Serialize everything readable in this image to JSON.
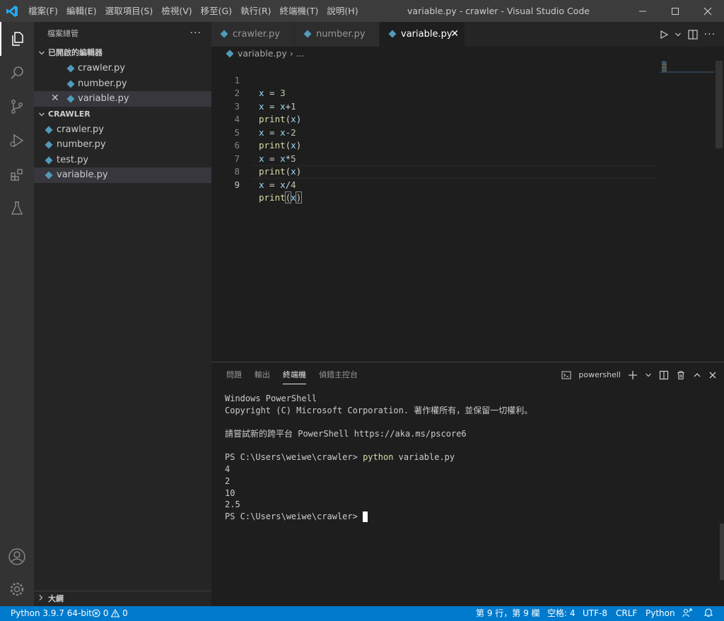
{
  "titlebar": {
    "menus": [
      "檔案(F)",
      "編輯(E)",
      "選取項目(S)",
      "檢視(V)",
      "移至(G)",
      "執行(R)",
      "終端機(T)",
      "說明(H)"
    ],
    "title": "variable.py - crawler - Visual Studio Code"
  },
  "sidebar": {
    "title": "檔案總管",
    "more": "···",
    "open_editors": {
      "header": "已開啟的編輯器",
      "items": [
        "crawler.py",
        "number.py",
        "variable.py"
      ]
    },
    "workspace": {
      "header": "CRAWLER",
      "items": [
        "crawler.py",
        "number.py",
        "test.py",
        "variable.py"
      ]
    },
    "outline": "大綱"
  },
  "tabs": [
    "crawler.py",
    "number.py",
    "variable.py"
  ],
  "breadcrumb": {
    "file": "variable.py",
    "rest": "..."
  },
  "editor": {
    "line_numbers": [
      "1",
      "2",
      "3",
      "4",
      "5",
      "6",
      "7",
      "8",
      "9"
    ],
    "current_line": 9,
    "lines": [
      [
        "x",
        " = ",
        "3"
      ],
      [
        "x",
        " = ",
        "x",
        "+",
        "1"
      ],
      [
        "print",
        "(",
        "x",
        ")"
      ],
      [
        "x",
        " = ",
        "x",
        "-",
        "2"
      ],
      [
        "print",
        "(",
        "x",
        ")"
      ],
      [
        "x",
        " = ",
        "x",
        "*",
        "5"
      ],
      [
        "print",
        "(",
        "x",
        ")"
      ],
      [
        "x",
        " = ",
        "x",
        "/",
        "4"
      ],
      [
        "print",
        "(",
        "x",
        ")"
      ]
    ]
  },
  "panel": {
    "tabs": [
      "問題",
      "輸出",
      "終端機",
      "偵錯主控台"
    ],
    "active_tab": "終端機",
    "shell": "powershell",
    "terminal": {
      "line1": "Windows PowerShell",
      "line2": "Copyright (C) Microsoft Corporation. 著作權所有，並保留一切權利。",
      "line3": "請嘗試新的跨平台 PowerShell https://aka.ms/pscore6",
      "prompt": "PS C:\\Users\\weiwe\\crawler> ",
      "command": "python",
      "command_args": " variable.py",
      "outputs": [
        "4",
        "2",
        "10",
        "2.5"
      ],
      "final_prompt": "PS C:\\Users\\weiwe\\crawler> "
    }
  },
  "statusbar": {
    "interpreter": "Python 3.9.7 64-bit",
    "errors": "0",
    "warnings": "0",
    "position": "第 9 行，第 9 欄",
    "spaces": "空格: 4",
    "encoding": "UTF-8",
    "eol": "CRLF",
    "language": "Python"
  },
  "colors": {
    "accent": "#007acc",
    "python_icon": "#519aba"
  }
}
